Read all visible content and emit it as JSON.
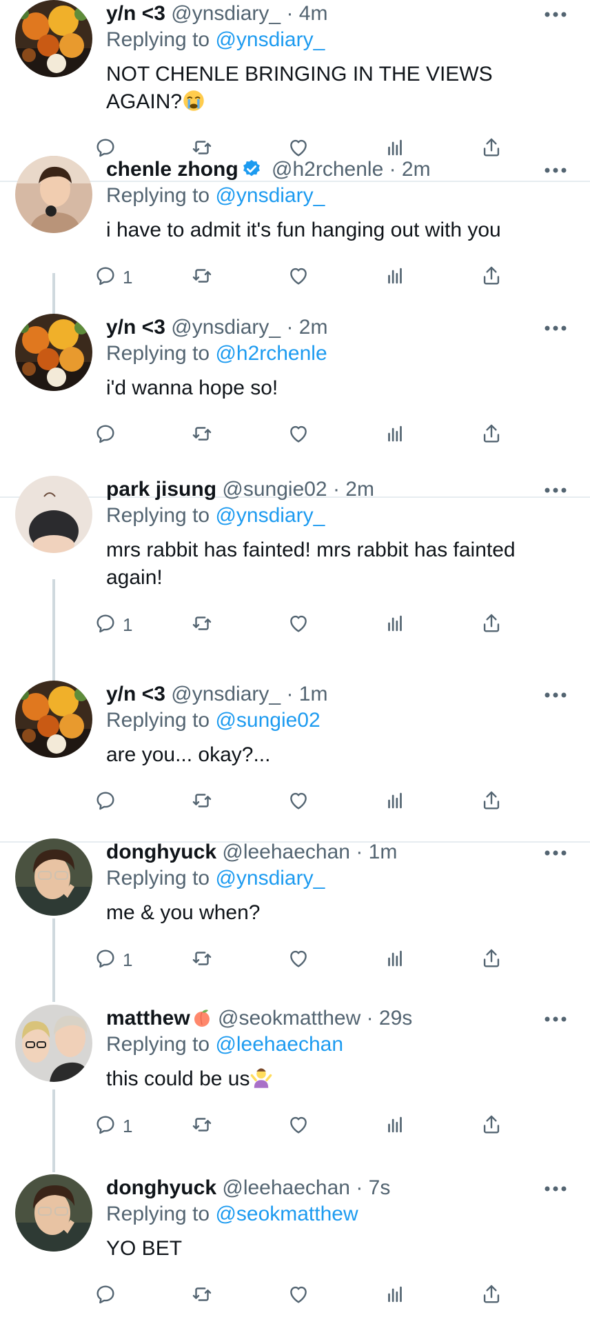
{
  "colors": {
    "link": "#1d9bf0",
    "meta": "#536471",
    "text": "#0f1419",
    "divider": "#e6ecf0",
    "thread_line": "#cfd9de"
  },
  "tweets": [
    {
      "name": "y/n <3",
      "handle": "@ynsdiary_",
      "time": "· 4m",
      "replying_prefix": "Replying to",
      "replying_to": "@ynsdiary_",
      "text": "NOT CHENLE BRINGING IN THE VIEWS AGAIN?",
      "emoji": "crying-face",
      "reply_count": "",
      "avatar": "flowers"
    },
    {
      "name": "chenle zhong",
      "verified": true,
      "handle": "@h2rchenle",
      "time": "· 2m",
      "replying_prefix": "Replying to",
      "replying_to": "@ynsdiary_",
      "text": "i have to admit it's fun hanging out with you",
      "reply_count": "1",
      "avatar": "chenle"
    },
    {
      "name": "y/n <3",
      "handle": "@ynsdiary_",
      "time": "· 2m",
      "replying_prefix": "Replying to",
      "replying_to": "@h2rchenle",
      "text": "i'd wanna hope so!",
      "reply_count": "",
      "avatar": "flowers"
    },
    {
      "name": "park jisung",
      "handle": "@sungie02",
      "time": "· 2m",
      "replying_prefix": "Replying to",
      "replying_to": "@ynsdiary_",
      "text": "mrs rabbit has fainted! mrs rabbit has fainted again!",
      "reply_count": "1",
      "avatar": "jisung"
    },
    {
      "name": "y/n <3",
      "handle": "@ynsdiary_",
      "time": "· 1m",
      "replying_prefix": "Replying to",
      "replying_to": "@sungie02",
      "text": "are you... okay?...",
      "reply_count": "",
      "avatar": "flowers"
    },
    {
      "name": "donghyuck",
      "handle": "@leehaechan",
      "time": "· 1m",
      "replying_prefix": "Replying to",
      "replying_to": "@ynsdiary_",
      "text": "me & you when?",
      "reply_count": "1",
      "avatar": "donghyuck"
    },
    {
      "name": "matthew",
      "name_emoji": "peach",
      "handle": "@seokmatthew",
      "time": "· 29s",
      "replying_prefix": "Replying to",
      "replying_to": "@leehaechan",
      "text": "this could be us",
      "emoji": "person-shrugging",
      "reply_count": "1",
      "avatar": "matthew"
    },
    {
      "name": "donghyuck",
      "handle": "@leehaechan",
      "time": "· 7s",
      "replying_prefix": "Replying to",
      "replying_to": "@seokmatthew",
      "text": "YO BET",
      "reply_count": "",
      "avatar": "donghyuck"
    }
  ],
  "icons": {
    "reply": "reply-icon",
    "retweet": "retweet-icon",
    "like": "heart-icon",
    "views": "views-icon",
    "share": "share-icon",
    "more": "more-icon"
  }
}
